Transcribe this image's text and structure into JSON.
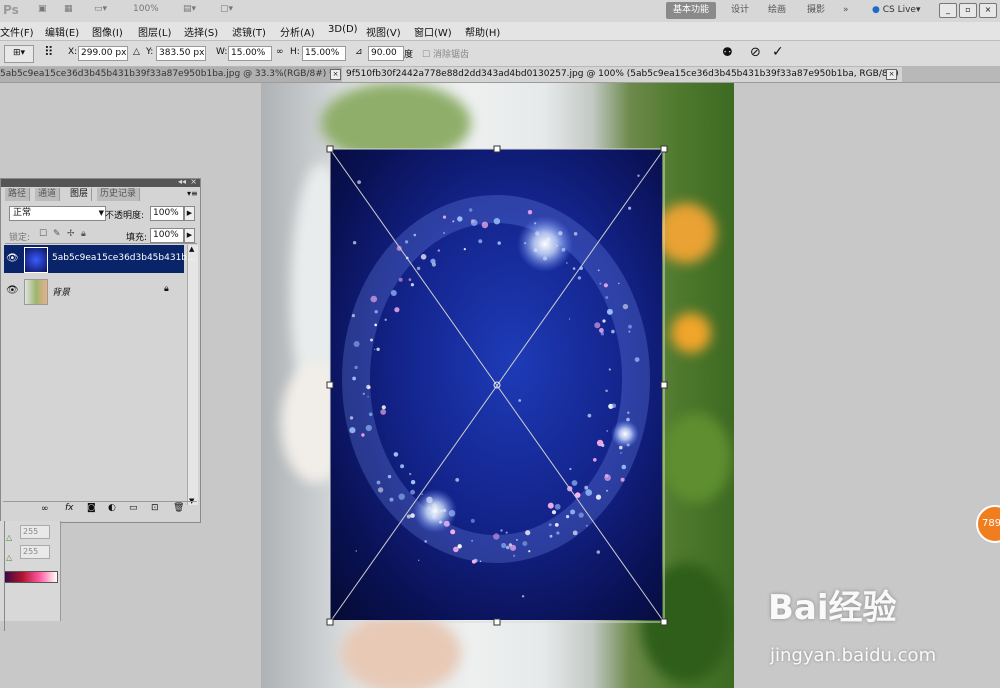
{
  "appbar": {
    "logo": "Ps",
    "zoom": "100%",
    "workspaces": [
      "基本功能",
      "设计",
      "绘画",
      "摄影"
    ],
    "more": "»",
    "cs_live": "CS Live"
  },
  "menu": [
    "文件(F)",
    "编辑(E)",
    "图像(I)",
    "图层(L)",
    "选择(S)",
    "滤镜(T)",
    "分析(A)",
    "3D(D)",
    "视图(V)",
    "窗口(W)",
    "帮助(H)"
  ],
  "options": {
    "x_label": "X:",
    "x_value": "299.00 px",
    "y_label": "Y:",
    "y_value": "383.50 px",
    "w_label": "W:",
    "w_value": "15.00%",
    "h_label": "H:",
    "h_value": "15.00%",
    "angle_value": "90.00",
    "angle_unit": "度",
    "antialias_label": "消除锯齿"
  },
  "tabs": [
    {
      "label": "5ab5c9ea15ce36d3b45b431b39f33a87e950b1ba.jpg @ 33.3%(RGB/8#) *"
    },
    {
      "label": "9f510fb30f2442a778e88d2dd343ad4bd0130257.jpg @ 100% (5ab5c9ea15ce36d3b45b431b39f33a87e950b1ba, RGB/8#)"
    }
  ],
  "layers_panel": {
    "tabs": [
      "路径",
      "通道",
      "图层",
      "历史记录"
    ],
    "blend_mode": "正常",
    "opacity_label": "不透明度:",
    "opacity_value": "100%",
    "lock_label": "锁定:",
    "fill_label": "填充:",
    "fill_value": "100%",
    "layers": [
      {
        "name": "5ab5c9ea15ce36d3b45b431b...",
        "selected": true
      },
      {
        "name": "背景",
        "selected": false
      }
    ]
  },
  "color_panel": {
    "values": [
      "255",
      "255"
    ]
  },
  "watermark": {
    "logo": "Bai经验",
    "url": "jingyan.baidu.com"
  },
  "badge": "789",
  "colors": {
    "layer_selected": "#0a246a",
    "badge": "#f07d1e"
  }
}
